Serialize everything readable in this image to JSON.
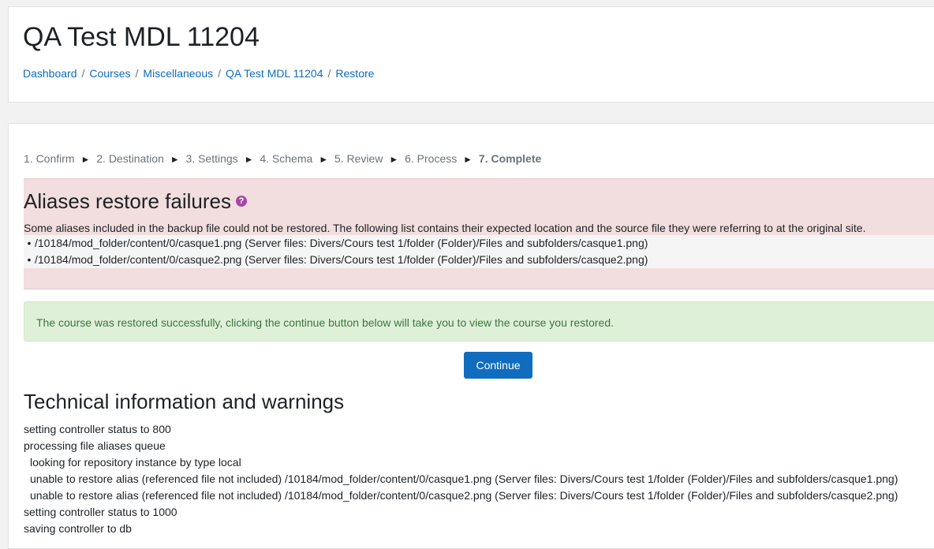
{
  "header": {
    "title": "QA Test MDL 11204",
    "breadcrumb": [
      {
        "label": "Dashboard"
      },
      {
        "label": "Courses"
      },
      {
        "label": "Miscellaneous"
      },
      {
        "label": "QA Test MDL 11204"
      },
      {
        "label": "Restore"
      }
    ],
    "separator": "/"
  },
  "progress": {
    "steps": [
      "1. Confirm",
      "2. Destination",
      "3. Settings",
      "4. Schema",
      "5. Review",
      "6. Process"
    ],
    "current": "7. Complete",
    "arrow": "►"
  },
  "aliases": {
    "title": "Aliases restore failures",
    "help_glyph": "?",
    "description": "Some aliases included in the backup file could not be restored. The following list contains their expected location and the source file they were referring to at the original site.",
    "items": [
      "/10184/mod_folder/content/0/casque1.png (Server files: Divers/Cours test 1/folder (Folder)/Files and subfolders/casque1.png)",
      "/10184/mod_folder/content/0/casque2.png (Server files: Divers/Cours test 1/folder (Folder)/Files and subfolders/casque2.png)"
    ],
    "bullet": "•"
  },
  "success": {
    "message": "The course was restored successfully, clicking the continue button below will take you to view the course you restored."
  },
  "continue_button": {
    "label": "Continue"
  },
  "technical": {
    "title": "Technical information and warnings",
    "lines": [
      {
        "text": "setting controller status to 800",
        "indent": false
      },
      {
        "text": "processing file aliases queue",
        "indent": false
      },
      {
        "text": "looking for repository instance by type local",
        "indent": true
      },
      {
        "text": "unable to restore alias (referenced file not included) /10184/mod_folder/content/0/casque1.png (Server files: Divers/Cours test 1/folder (Folder)/Files and subfolders/casque1.png)",
        "indent": true
      },
      {
        "text": "unable to restore alias (referenced file not included) /10184/mod_folder/content/0/casque2.png (Server files: Divers/Cours test 1/folder (Folder)/Files and subfolders/casque2.png)",
        "indent": true
      },
      {
        "text": "setting controller status to 1000",
        "indent": false
      },
      {
        "text": "saving controller to db",
        "indent": false
      }
    ]
  },
  "colors": {
    "link": "#0f6cbf",
    "primary_button": "#0f6cbf",
    "error_bg": "#f2dede",
    "success_bg": "#dff0d8",
    "success_text": "#3c763d",
    "help_icon": "#a349a4"
  }
}
